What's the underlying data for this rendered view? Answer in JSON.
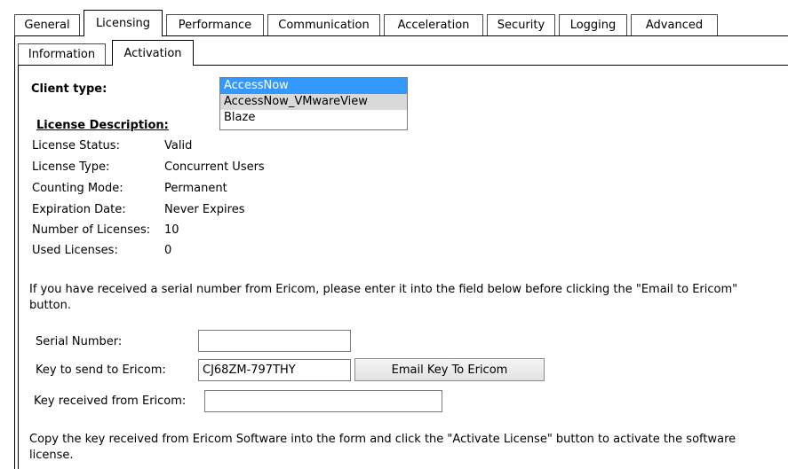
{
  "tabs": [
    {
      "label": "General"
    },
    {
      "label": "Licensing"
    },
    {
      "label": "Performance"
    },
    {
      "label": "Communication"
    },
    {
      "label": "Acceleration"
    },
    {
      "label": "Security"
    },
    {
      "label": "Logging"
    },
    {
      "label": "Advanced"
    }
  ],
  "subtabs": [
    {
      "label": "Information"
    },
    {
      "label": "Activation"
    }
  ],
  "client_type": {
    "label": "Client type:",
    "options": [
      "AccessNow",
      "AccessNow_VMwareView",
      "Blaze"
    ],
    "selected": "AccessNow"
  },
  "license": {
    "heading": "License Description:",
    "rows": [
      {
        "label": "License Status:",
        "value": "Valid"
      },
      {
        "label": "License Type:",
        "value": "Concurrent Users"
      },
      {
        "label": "Counting Mode:",
        "value": "Permanent"
      },
      {
        "label": "Expiration Date:",
        "value": "Never Expires"
      },
      {
        "label": "Number of Licenses:",
        "value": "10"
      },
      {
        "label": "Used Licenses:",
        "value": "0"
      }
    ]
  },
  "instructions1": "If you have received a serial number from Ericom, please enter it into the field below before clicking the \"Email to Ericom\" button.",
  "form": {
    "serial_label": "Serial Number:",
    "serial_value": "",
    "key_send_label": "Key to send to Ericom:",
    "key_send_value": "CJ68ZM-797THY",
    "email_button": "Email Key To Ericom",
    "key_received_label": "Key received from Ericom:",
    "key_received_value": ""
  },
  "instructions2": "Copy the key received from Ericom Software into the form and click the \"Activate License\" button to activate the software license."
}
